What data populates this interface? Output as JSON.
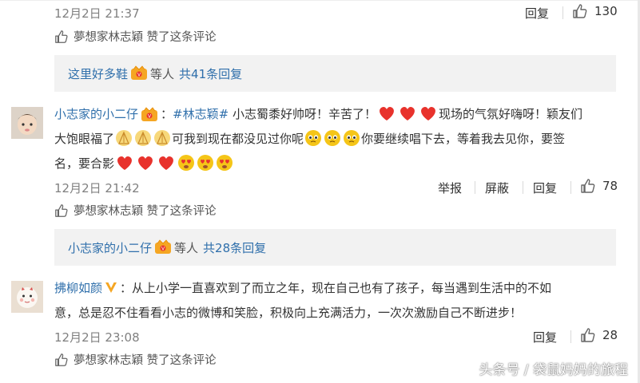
{
  "comments": [
    {
      "time": "12月2日 21:37",
      "reply_label": "回复",
      "like_count": "130",
      "liked_by": "夢想家林志穎 赞了这条评论",
      "reply_summary": {
        "user": "这里好多鞋",
        "others": "等人",
        "count": "共41条回复"
      }
    },
    {
      "user": "小志家的小二仔",
      "text_parts": {
        "sep": "：",
        "tag": "#林志颖#",
        "t1": " 小志蜀黍好帅呀！辛苦了！",
        "t2": "现场的气氛好嗨呀！颖友们",
        "t3": "大饱眼福了",
        "t4": "可我到现在都没见过你呢",
        "t5": "你要继续唱下去，等着我去见你，要签",
        "t6": "名，要合影"
      },
      "time": "12月2日 21:42",
      "report_label": "举报",
      "block_label": "屏蔽",
      "reply_label": "回复",
      "like_count": "78",
      "liked_by": "夢想家林志穎 赞了这条评论",
      "reply_summary": {
        "user": "小志家的小二仔",
        "others": "等人",
        "count": "共28条回复"
      }
    },
    {
      "user": "拂柳如颜",
      "text_line1": "：从上小学一直喜欢到了而立之年，现在自己也有了孩子，每当遇到生活中的不如",
      "text_line2": "意，总是忍不住看看小志的微博和笑脸，积极向上充满活力，一次次激励自己不断进步！",
      "time": "12月2日 23:08",
      "reply_label": "回复",
      "like_count": "28",
      "liked_by": "夢想家林志穎 赞了这条评论"
    }
  ],
  "watermark": "头条号 / 袋鼠妈妈的旅程",
  "colors": {
    "link": "#2f6fab",
    "reply_bg": "#f2f2f2",
    "time": "#808080",
    "heart": "#e8322c",
    "emoji": "#f5c518"
  }
}
